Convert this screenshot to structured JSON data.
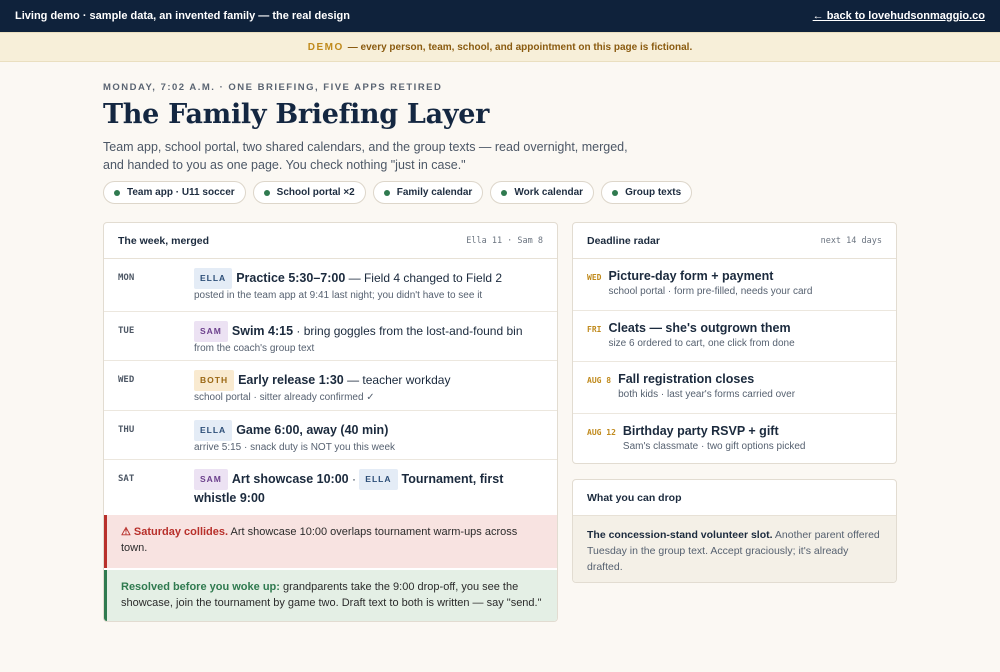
{
  "topbar": {
    "left": "Living demo · sample data, an invented family — the real design",
    "back_link": "← back to lovehudsonmaggio.co"
  },
  "notice": {
    "tag": "DEMO",
    "text": "— every person, team, school, and appointment on this page is fictional."
  },
  "hero": {
    "eyebrow": "MONDAY, 7:02 A.M. · ONE BRIEFING, FIVE APPS RETIRED",
    "title": "The Family Briefing Layer",
    "lede": "Team app, school portal, two shared calendars, and the group texts — read overnight, merged, and handed to you as one page. You check nothing \"just in case.\""
  },
  "chips": [
    "Team app · U11 soccer",
    "School portal ×2",
    "Family calendar",
    "Work calendar",
    "Group texts"
  ],
  "week": {
    "title": "The week, merged",
    "meta": "Ella 11 · Sam 8",
    "days": [
      {
        "day": "MON",
        "tag": "ELLA",
        "main": "Practice 5:30–7:00",
        "rest": " — Field 4 changed to Field 2",
        "sub": "posted in the team app at 9:41 last night; you didn't have to see it"
      },
      {
        "day": "TUE",
        "tag": "SAM",
        "main": "Swim 4:15",
        "rest": " · bring goggles from the lost-and-found bin",
        "sub": "from the coach's group text"
      },
      {
        "day": "WED",
        "tag": "BOTH",
        "main": "Early release 1:30",
        "rest": " — teacher workday",
        "sub": "school portal · sitter already confirmed ✓"
      },
      {
        "day": "THU",
        "tag": "ELLA",
        "main": "Game 6:00, away (40 min)",
        "rest": "",
        "sub": "arrive 5:15 · snack duty is NOT you this week"
      },
      {
        "day": "SAT",
        "tag": "SAM",
        "main": "Art showcase 10:00",
        "sep": " · ",
        "tag2": "ELLA",
        "main2": "Tournament, first whistle 9:00"
      }
    ],
    "alert": {
      "strong": "⚠ Saturday collides.",
      "text": " Art showcase 10:00 overlaps tournament warm-ups across town."
    },
    "resolved": {
      "strong": "Resolved before you woke up:",
      "text": " grandparents take the 9:00 drop-off, you see the showcase, join the tournament by game two. Draft text to both is written — say \"send.\""
    }
  },
  "radar": {
    "title": "Deadline radar",
    "meta": "next 14 days",
    "items": [
      {
        "when": "WED",
        "title": "Picture-day form + payment",
        "sub": "school portal · form pre-filled, needs your card"
      },
      {
        "when": "FRI",
        "title": "Cleats — she's outgrown them",
        "sub": "size 6 ordered to cart, one click from done"
      },
      {
        "when": "AUG 8",
        "title": "Fall registration closes",
        "sub": "both kids · last year's forms carried over"
      },
      {
        "when": "AUG 12",
        "title": "Birthday party RSVP + gift",
        "sub": "Sam's classmate · two gift options picked"
      }
    ]
  },
  "drop": {
    "title": "What you can drop",
    "strong": "The concession-stand volunteer slot.",
    "text": " Another parent offered Tuesday in the group text. Accept graciously; it's already drafted."
  }
}
